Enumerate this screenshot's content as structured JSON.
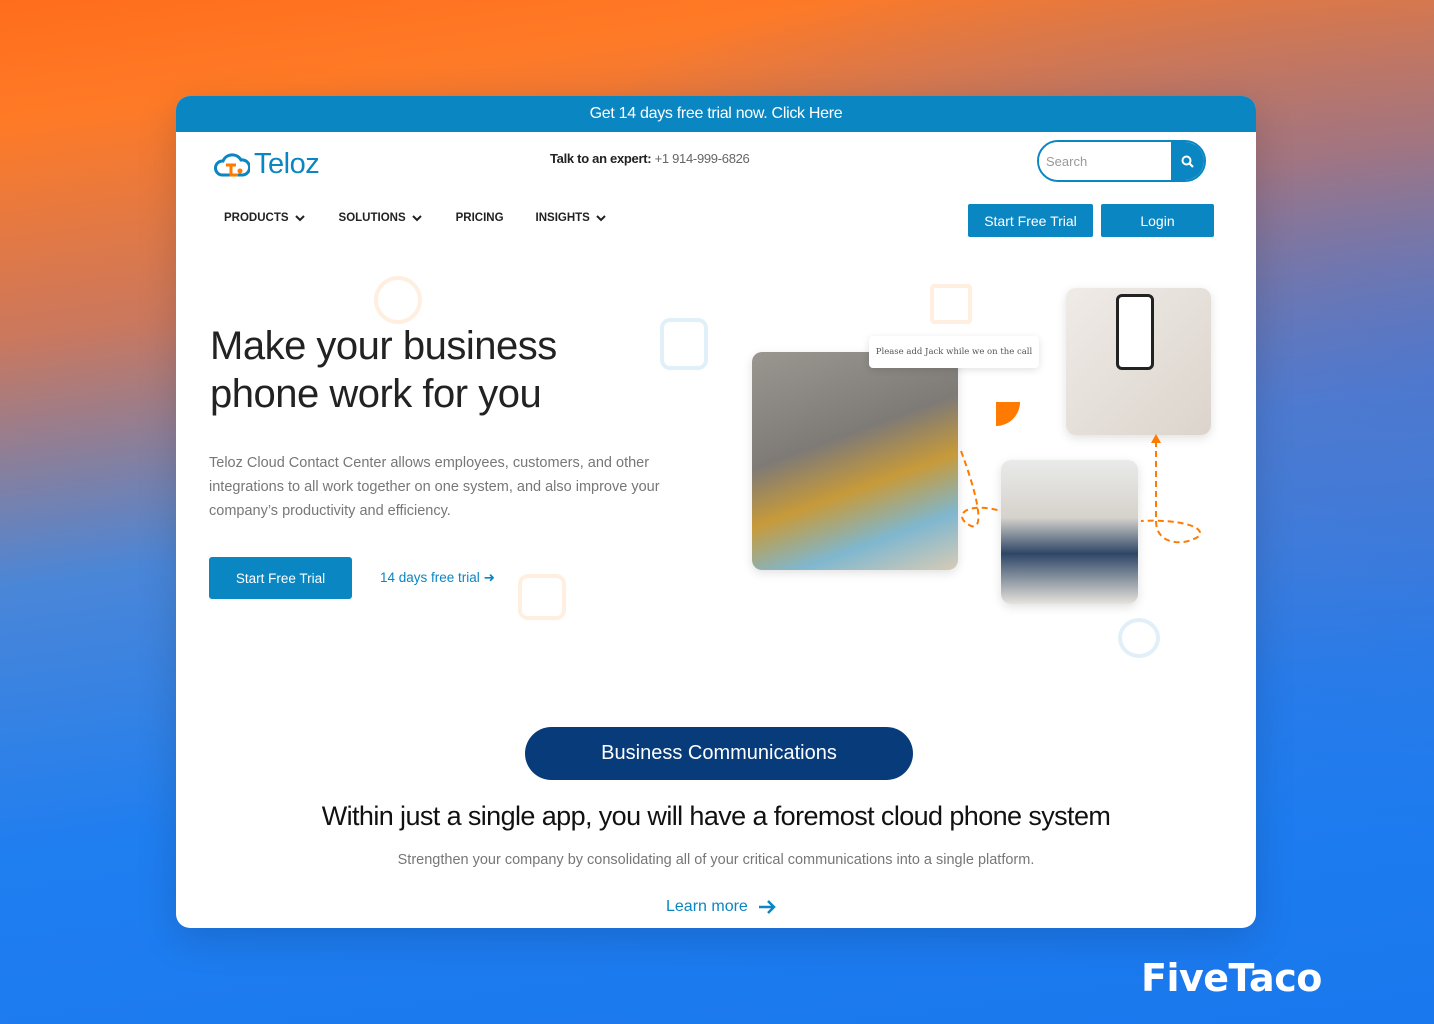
{
  "banner": {
    "text": "Get 14 days free trial now. Click Here"
  },
  "header": {
    "logo": "Teloz",
    "expert_label": "Talk to an expert:",
    "expert_phone": "+1 914-999-6826",
    "search_placeholder": "Search",
    "start_trial": "Start Free Trial",
    "login": "Login"
  },
  "nav": {
    "items": [
      {
        "label": "PRODUCTS",
        "dropdown": true
      },
      {
        "label": "SOLUTIONS",
        "dropdown": true
      },
      {
        "label": "PRICING",
        "dropdown": false
      },
      {
        "label": "INSIGHTS",
        "dropdown": true
      }
    ]
  },
  "hero": {
    "title": "Make your business phone work for you",
    "description": "Teloz Cloud Contact Center allows employees, customers, and other integrations to all work together on one system, and also improve your company’s productivity and efficiency.",
    "cta": "Start Free Trial",
    "link": "14 days free trial",
    "chat_bubble": "Please add Jack while we on the call"
  },
  "section": {
    "pill": "Business Communications",
    "title": "Within just a single app, you will have a foremost cloud phone system",
    "subtitle": "Strengthen your company by consolidating all of your critical communications into a single platform.",
    "link": "Learn more"
  },
  "watermark": "FiveTaco",
  "colors": {
    "primary": "#0a86c2",
    "navy": "#073b7a",
    "accent": "#ff7a00"
  }
}
